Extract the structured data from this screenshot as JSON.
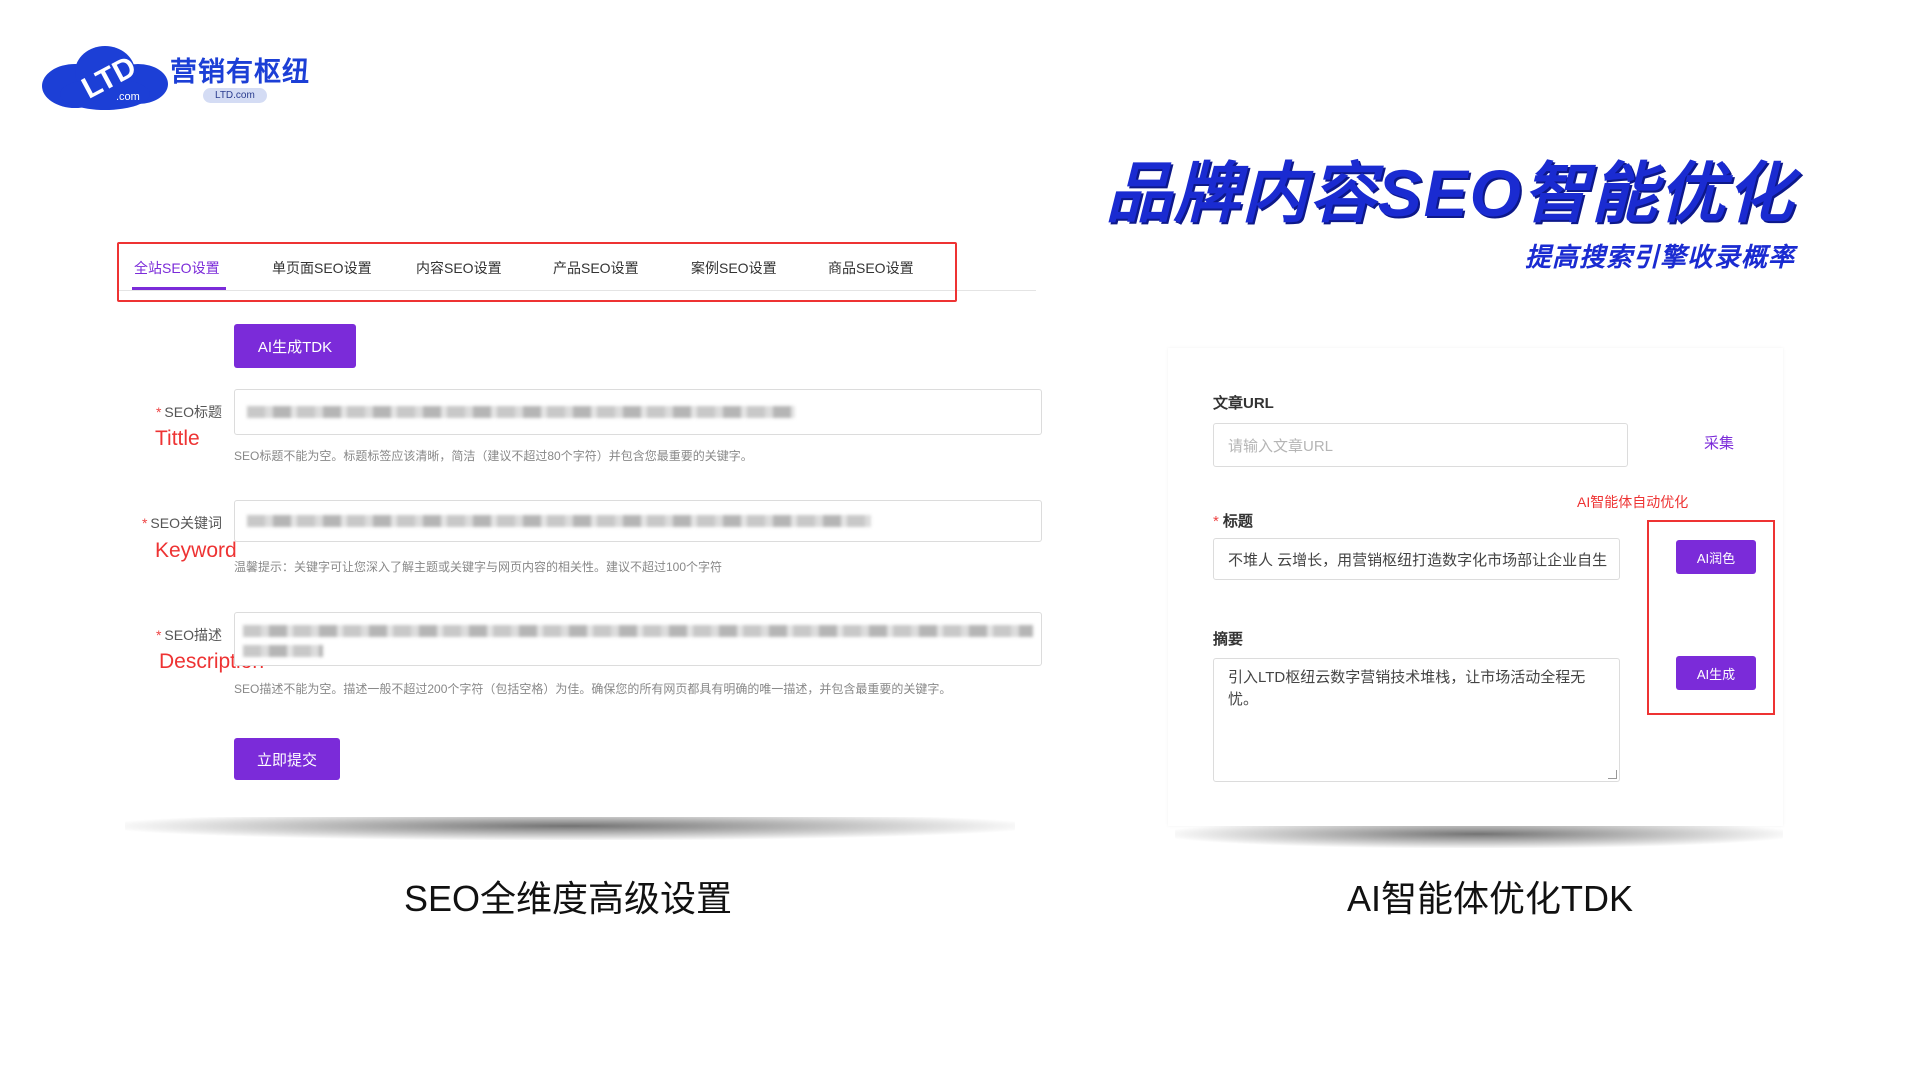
{
  "logo": {
    "mark_text": "LTD",
    "mark_sub": ".com",
    "name": "营销有枢纽",
    "sub": "LTD.com"
  },
  "headline": "品牌内容SEO智能优化",
  "subheadline": "提高搜索引擎收录概率",
  "left_panel": {
    "tabs": [
      {
        "label": "全站SEO设置",
        "active": true
      },
      {
        "label": "单页面SEO设置",
        "active": false
      },
      {
        "label": "内容SEO设置",
        "active": false
      },
      {
        "label": "产品SEO设置",
        "active": false
      },
      {
        "label": "案例SEO设置",
        "active": false
      },
      {
        "label": "商品SEO设置",
        "active": false
      }
    ],
    "ai_button": "AI生成TDK",
    "fields": [
      {
        "label": "SEO标题",
        "annotation": "Tittle",
        "hint": "SEO标题不能为空。标题标签应该清晰，简洁（建议不超过80个字符）并包含您最重要的关键字。"
      },
      {
        "label": "SEO关键词",
        "annotation": "Keyword",
        "hint": "温馨提示：关键字可让您深入了解主题或关键字与网页内容的相关性。建议不超过100个字符"
      },
      {
        "label": "SEO描述",
        "annotation": "Description",
        "hint": "SEO描述不能为空。描述一般不超过200个字符（包括空格）为佳。确保您的所有网页都具有明确的唯一描述，并包含最重要的关键字。"
      }
    ],
    "submit_button": "立即提交",
    "caption": "SEO全维度高级设置"
  },
  "right_panel": {
    "url_label": "文章URL",
    "url_placeholder": "请输入文章URL",
    "collect_link": "采集",
    "ai_note": "AI智能体自动优化",
    "title_label": "标题",
    "title_value": "不堆人 云增长，用营销枢纽打造数字化市场部让企业自生",
    "polish_button": "AI润色",
    "summary_label": "摘要",
    "summary_value": "引入LTD枢纽云数字营销技术堆栈，让市场活动全程无忧。",
    "generate_button": "AI生成",
    "caption": "AI智能体优化TDK"
  },
  "colors": {
    "accent_purple": "#7b2bd9",
    "brand_blue": "#1a2bd1",
    "annotation_red": "#e33333"
  }
}
